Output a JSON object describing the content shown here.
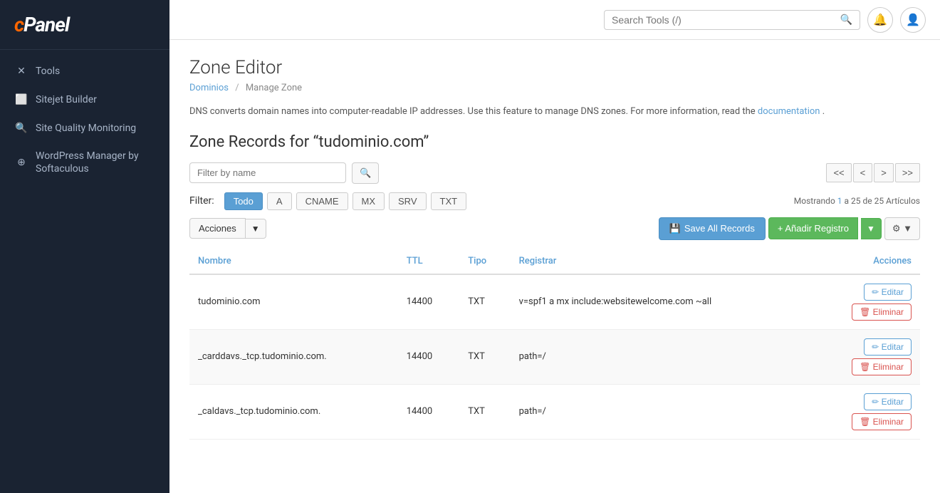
{
  "sidebar": {
    "logo": "cPanel",
    "items": [
      {
        "id": "tools",
        "label": "Tools",
        "icon": "wrench"
      },
      {
        "id": "sitejet",
        "label": "Sitejet Builder",
        "icon": "sitejet"
      },
      {
        "id": "site-quality",
        "label": "Site Quality Monitoring",
        "icon": "search"
      },
      {
        "id": "wordpress",
        "label": "WordPress Manager by Softaculous",
        "icon": "wp"
      }
    ]
  },
  "header": {
    "search_placeholder": "Search Tools (/)"
  },
  "breadcrumb": {
    "part1": "Dominios",
    "sep": "/",
    "part2": "Manage Zone"
  },
  "page": {
    "title": "Zone Editor",
    "zone_title": "Zone Records for “tudominio.com”",
    "info_text": "DNS converts domain names into computer-readable IP addresses. Use this feature to manage DNS zones. For more information, read the",
    "info_link": "documentation",
    "info_end": "."
  },
  "filter": {
    "placeholder": "Filter by name",
    "label": "Filter:",
    "tabs": [
      "Todo",
      "A",
      "CNAME",
      "MX",
      "SRV",
      "TXT"
    ],
    "active_tab": "Todo",
    "showing": "Mostrando",
    "showing_from": "1",
    "showing_mid": "a 25 de 25 Artículos"
  },
  "toolbar": {
    "acciones_label": "Acciones",
    "save_all_label": "Save All Records",
    "add_record_label": "+ Añadir Registro"
  },
  "table": {
    "headers": [
      "Nombre",
      "TTL",
      "Tipo",
      "Registrar",
      "Acciones"
    ],
    "rows": [
      {
        "nombre": "tudominio.com",
        "ttl": "14400",
        "tipo": "TXT",
        "registrar": "v=spf1 a mx include:websitewelcome.com ~all",
        "edit_label": "Editar",
        "delete_label": "Eliminar"
      },
      {
        "nombre": "_carddavs._tcp.tudominio.com.",
        "ttl": "14400",
        "tipo": "TXT",
        "registrar": "path=/",
        "edit_label": "Editar",
        "delete_label": "Eliminar"
      },
      {
        "nombre": "_caldavs._tcp.tudominio.com.",
        "ttl": "14400",
        "tipo": "TXT",
        "registrar": "path=/",
        "edit_label": "Editar",
        "delete_label": "Eliminar"
      }
    ]
  },
  "pagination": {
    "first": "<<",
    "prev": "<",
    "next": ">",
    "last": ">>"
  }
}
